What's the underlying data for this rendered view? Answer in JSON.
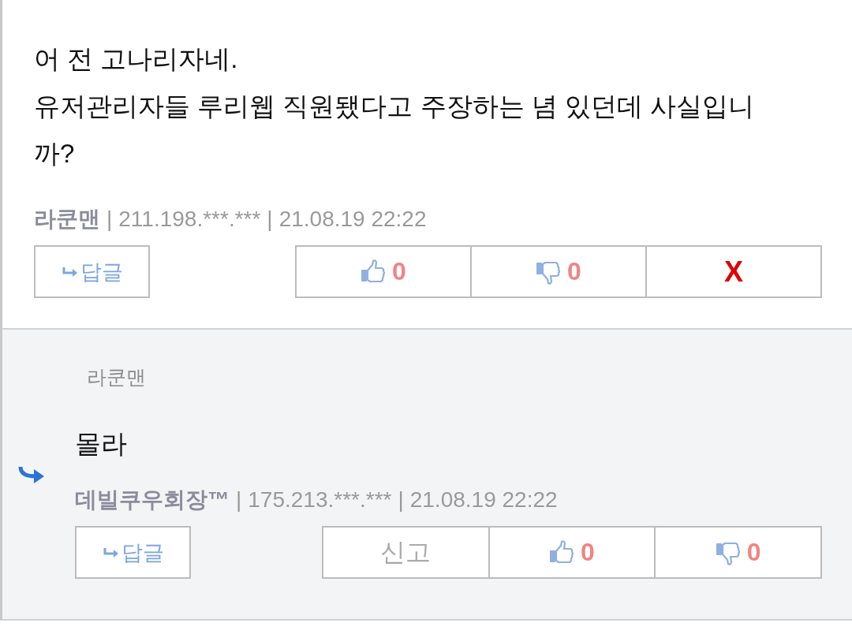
{
  "comments": [
    {
      "kind": "comment",
      "lines": [
        "어 전 고나리자네.",
        "유저관리자들 루리웹 직원됐다고 주장하는 념 있던데 사실입니까?"
      ],
      "meta": [
        {
          "kind": "author",
          "text": "라쿤맨"
        },
        {
          "kind": "separator",
          "text": "|"
        },
        {
          "kind": "ip",
          "text": "211.198.***.***"
        },
        {
          "kind": "separator",
          "text": "|"
        },
        {
          "kind": "time",
          "text": "21.08.19 22:22"
        }
      ],
      "reply_label": "답글",
      "actions": [
        {
          "kind": "like",
          "count": "0"
        },
        {
          "kind": "dislike",
          "count": "0"
        },
        {
          "kind": "delete",
          "label": "X"
        }
      ]
    },
    {
      "kind": "reply",
      "quote_author": "라쿤맨",
      "lines": [
        "몰라"
      ],
      "meta": [
        {
          "kind": "author",
          "text": "데빌쿠우회장™"
        },
        {
          "kind": "separator",
          "text": "|"
        },
        {
          "kind": "ip",
          "text": "175.213.***.***"
        },
        {
          "kind": "separator",
          "text": "|"
        },
        {
          "kind": "time",
          "text": "21.08.19 22:22"
        }
      ],
      "reply_label": "답글",
      "actions": [
        {
          "kind": "report",
          "label": "신고"
        },
        {
          "kind": "like",
          "count": "0"
        },
        {
          "kind": "dislike",
          "count": "0"
        }
      ]
    }
  ]
}
